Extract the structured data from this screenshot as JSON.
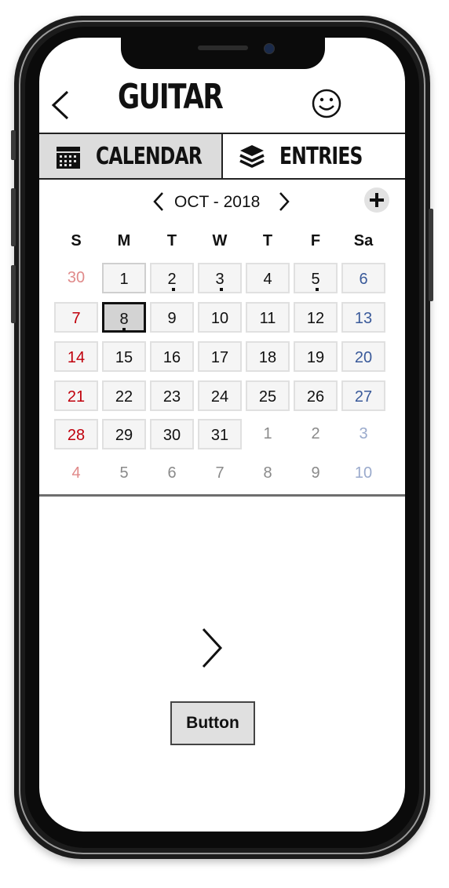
{
  "header": {
    "title": "GUITAR"
  },
  "tabs": [
    {
      "label": "CALENDAR",
      "icon": "calendar-icon",
      "active": true
    },
    {
      "label": "ENTRIES",
      "icon": "layers-icon",
      "active": false
    }
  ],
  "month": {
    "label": "OCT - 2018"
  },
  "weekdays": [
    "S",
    "M",
    "T",
    "W",
    "T",
    "F",
    "Sa"
  ],
  "weeks": [
    [
      "30",
      "1",
      "2",
      "3",
      "4",
      "5",
      "6"
    ],
    [
      "7",
      "8",
      "9",
      "10",
      "11",
      "12",
      "13"
    ],
    [
      "14",
      "15",
      "16",
      "17",
      "18",
      "19",
      "20"
    ],
    [
      "21",
      "22",
      "23",
      "24",
      "25",
      "26",
      "27"
    ],
    [
      "28",
      "29",
      "30",
      "31",
      "1",
      "2",
      "3"
    ],
    [
      "4",
      "5",
      "6",
      "7",
      "8",
      "9",
      "10"
    ]
  ],
  "calendar_state": {
    "selected_day": "8",
    "days_with_entries": [
      "2",
      "3",
      "5",
      "8"
    ]
  },
  "colors": {
    "sunday": "#c0000c",
    "saturday": "#3a5a9a",
    "sunday_faded": "#e08a8a",
    "saturday_faded": "#9aaacc",
    "other_month": "#8a8a8a",
    "text": "#111111",
    "tab_active_bg": "#dcdcdc"
  },
  "action_button": {
    "label": "Button"
  }
}
